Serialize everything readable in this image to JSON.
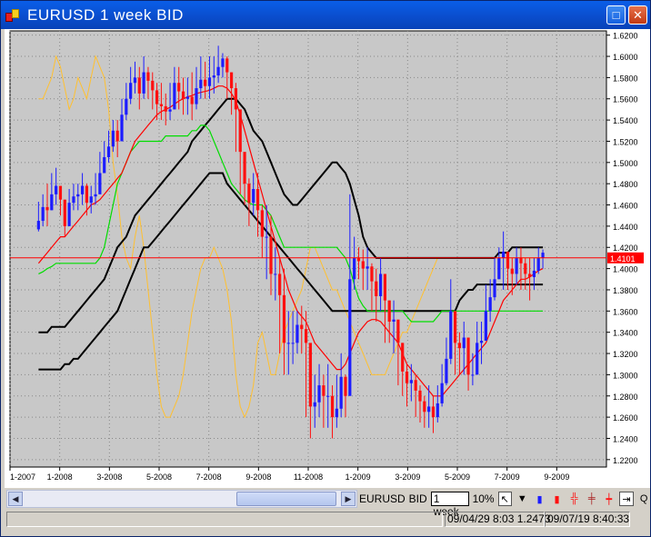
{
  "window": {
    "title": "EURUSD 1  week BID",
    "max_symbol": "□",
    "close_symbol": "✕"
  },
  "colors": {
    "title_bar": "#0a52d8",
    "chart_bg": "#c8c8c8",
    "bull_candle": "#1c1cff",
    "bear_candle": "#ff1010",
    "price_line": "#ff0000",
    "red_ma": "#ff0000",
    "green_ma": "#00dd00",
    "envelope": "#000000",
    "oscillator": "#ffc030"
  },
  "chart_data": {
    "type": "candlestick",
    "symbol": "EURUSD",
    "timeframe": "1 week",
    "price_axis": [
      "1.6200",
      "1.6000",
      "1.5800",
      "1.5600",
      "1.5400",
      "1.5200",
      "1.5000",
      "1.4800",
      "1.4600",
      "1.4400",
      "1.4200",
      "1.4000",
      "1.3800",
      "1.3600",
      "1.3400",
      "1.3200",
      "1.3000",
      "1.2800",
      "1.2600",
      "1.2400",
      "1.2200"
    ],
    "ylim": [
      1.213,
      1.624
    ],
    "time_axis": [
      "1-2007",
      "1-2008",
      "3-2008",
      "5-2008",
      "7-2008",
      "9-2008",
      "11-2008",
      "1-2009",
      "3-2009",
      "5-2009",
      "7-2009",
      "9-2009"
    ],
    "current_price": "1.4101",
    "current_price_value": 1.4101,
    "weeks": 136,
    "close": [
      1.445,
      1.458,
      1.455,
      1.47,
      1.478,
      1.465,
      1.44,
      1.462,
      1.468,
      1.47,
      1.478,
      1.462,
      1.468,
      1.47,
      1.49,
      1.505,
      1.515,
      1.53,
      1.52,
      1.545,
      1.56,
      1.575,
      1.58,
      1.565,
      1.585,
      1.577,
      1.568,
      1.555,
      1.553,
      1.548,
      1.55,
      1.575,
      1.567,
      1.56,
      1.562,
      1.555,
      1.57,
      1.578,
      1.572,
      1.58,
      1.582,
      1.59,
      1.598,
      1.585,
      1.57,
      1.55,
      1.51,
      1.48,
      1.462,
      1.475,
      1.455,
      1.43,
      1.43,
      1.395,
      1.395,
      1.375,
      1.33,
      1.33,
      1.33,
      1.347,
      1.343,
      1.33,
      1.27,
      1.274,
      1.29,
      1.28,
      1.28,
      1.26,
      1.268,
      1.298,
      1.28,
      1.39,
      1.41,
      1.407,
      1.4,
      1.402,
      1.388,
      1.374,
      1.395,
      1.37,
      1.35,
      1.352,
      1.33,
      1.303,
      1.292,
      1.295,
      1.285,
      1.275,
      1.265,
      1.27,
      1.26,
      1.273,
      1.292,
      1.315,
      1.36,
      1.33,
      1.325,
      1.335,
      1.3,
      1.3,
      1.33,
      1.332,
      1.36,
      1.373,
      1.39,
      1.41,
      1.416,
      1.4,
      1.395,
      1.41,
      1.405,
      1.395,
      1.392,
      1.398,
      1.41,
      1.415
    ],
    "high": [
      1.463,
      1.47,
      1.48,
      1.49,
      1.495,
      1.475,
      1.465,
      1.475,
      1.48,
      1.48,
      1.49,
      1.48,
      1.478,
      1.49,
      1.51,
      1.52,
      1.53,
      1.54,
      1.54,
      1.56,
      1.575,
      1.59,
      1.595,
      1.59,
      1.6,
      1.59,
      1.585,
      1.575,
      1.575,
      1.565,
      1.575,
      1.59,
      1.59,
      1.58,
      1.58,
      1.585,
      1.59,
      1.6,
      1.595,
      1.6,
      1.6,
      1.61,
      1.603,
      1.6,
      1.585,
      1.575,
      1.55,
      1.495,
      1.485,
      1.49,
      1.49,
      1.46,
      1.46,
      1.45,
      1.42,
      1.41,
      1.4,
      1.36,
      1.36,
      1.36,
      1.365,
      1.36,
      1.32,
      1.3,
      1.31,
      1.3,
      1.31,
      1.29,
      1.3,
      1.32,
      1.3,
      1.47,
      1.43,
      1.42,
      1.418,
      1.42,
      1.405,
      1.4,
      1.41,
      1.39,
      1.37,
      1.37,
      1.35,
      1.33,
      1.31,
      1.31,
      1.3,
      1.29,
      1.28,
      1.29,
      1.28,
      1.29,
      1.31,
      1.335,
      1.39,
      1.36,
      1.34,
      1.35,
      1.32,
      1.32,
      1.35,
      1.35,
      1.385,
      1.39,
      1.41,
      1.42,
      1.435,
      1.415,
      1.41,
      1.42,
      1.42,
      1.41,
      1.41,
      1.41,
      1.42,
      1.418
    ],
    "low": [
      1.435,
      1.44,
      1.44,
      1.455,
      1.46,
      1.45,
      1.43,
      1.44,
      1.455,
      1.455,
      1.46,
      1.45,
      1.452,
      1.46,
      1.48,
      1.49,
      1.5,
      1.51,
      1.505,
      1.52,
      1.54,
      1.555,
      1.565,
      1.55,
      1.56,
      1.56,
      1.55,
      1.54,
      1.54,
      1.535,
      1.54,
      1.55,
      1.55,
      1.545,
      1.545,
      1.54,
      1.55,
      1.56,
      1.56,
      1.56,
      1.565,
      1.575,
      1.58,
      1.56,
      1.545,
      1.51,
      1.47,
      1.46,
      1.44,
      1.45,
      1.43,
      1.41,
      1.39,
      1.375,
      1.37,
      1.32,
      1.3,
      1.3,
      1.31,
      1.32,
      1.32,
      1.26,
      1.24,
      1.25,
      1.26,
      1.25,
      1.25,
      1.24,
      1.25,
      1.26,
      1.26,
      1.38,
      1.38,
      1.39,
      1.38,
      1.38,
      1.36,
      1.35,
      1.36,
      1.33,
      1.33,
      1.32,
      1.29,
      1.28,
      1.27,
      1.275,
      1.26,
      1.255,
      1.25,
      1.25,
      1.245,
      1.255,
      1.27,
      1.29,
      1.31,
      1.3,
      1.3,
      1.3,
      1.285,
      1.29,
      1.31,
      1.31,
      1.35,
      1.35,
      1.37,
      1.39,
      1.38,
      1.38,
      1.375,
      1.385,
      1.38,
      1.38,
      1.37,
      1.38,
      1.395,
      1.4
    ],
    "red_ma": [
      1.405,
      1.41,
      1.415,
      1.42,
      1.425,
      1.43,
      1.43,
      1.435,
      1.44,
      1.445,
      1.45,
      1.455,
      1.46,
      1.462,
      1.465,
      1.47,
      1.475,
      1.48,
      1.485,
      1.49,
      1.5,
      1.51,
      1.52,
      1.525,
      1.53,
      1.535,
      1.54,
      1.545,
      1.548,
      1.55,
      1.552,
      1.555,
      1.558,
      1.56,
      1.562,
      1.563,
      1.565,
      1.566,
      1.567,
      1.568,
      1.57,
      1.572,
      1.572,
      1.57,
      1.565,
      1.558,
      1.545,
      1.53,
      1.515,
      1.5,
      1.485,
      1.47,
      1.455,
      1.44,
      1.425,
      1.41,
      1.395,
      1.38,
      1.37,
      1.36,
      1.355,
      1.35,
      1.34,
      1.33,
      1.325,
      1.32,
      1.315,
      1.31,
      1.305,
      1.305,
      1.31,
      1.32,
      1.33,
      1.34,
      1.345,
      1.35,
      1.352,
      1.352,
      1.35,
      1.345,
      1.34,
      1.335,
      1.33,
      1.32,
      1.31,
      1.305,
      1.3,
      1.295,
      1.29,
      1.285,
      1.28,
      1.28,
      1.28,
      1.285,
      1.29,
      1.295,
      1.3,
      1.305,
      1.31,
      1.315,
      1.32,
      1.325,
      1.33,
      1.34,
      1.35,
      1.36,
      1.37,
      1.375,
      1.38,
      1.385,
      1.39,
      1.39,
      1.392,
      1.395,
      1.398,
      1.4
    ],
    "green_ma": [
      1.395,
      1.397,
      1.4,
      1.402,
      1.405,
      1.405,
      1.405,
      1.405,
      1.405,
      1.405,
      1.405,
      1.405,
      1.405,
      1.405,
      1.41,
      1.42,
      1.44,
      1.46,
      1.48,
      1.49,
      1.5,
      1.51,
      1.515,
      1.52,
      1.52,
      1.52,
      1.52,
      1.52,
      1.52,
      1.525,
      1.525,
      1.525,
      1.525,
      1.525,
      1.525,
      1.53,
      1.53,
      1.535,
      1.535,
      1.53,
      1.52,
      1.51,
      1.5,
      1.49,
      1.48,
      1.475,
      1.47,
      1.465,
      1.462,
      1.46,
      1.46,
      1.46,
      1.455,
      1.45,
      1.44,
      1.43,
      1.42,
      1.42,
      1.42,
      1.42,
      1.42,
      1.42,
      1.42,
      1.42,
      1.42,
      1.42,
      1.42,
      1.42,
      1.42,
      1.415,
      1.41,
      1.4,
      1.385,
      1.372,
      1.365,
      1.36,
      1.36,
      1.36,
      1.36,
      1.36,
      1.36,
      1.36,
      1.36,
      1.36,
      1.355,
      1.35,
      1.35,
      1.35,
      1.35,
      1.35,
      1.35,
      1.355,
      1.36,
      1.36,
      1.36,
      1.36,
      1.36,
      1.36,
      1.36,
      1.36,
      1.36,
      1.36,
      1.36,
      1.36,
      1.36,
      1.36,
      1.36,
      1.36,
      1.36,
      1.36,
      1.36,
      1.36,
      1.36,
      1.36,
      1.36,
      1.36
    ],
    "env_upper": [
      1.34,
      1.34,
      1.34,
      1.345,
      1.345,
      1.345,
      1.345,
      1.35,
      1.355,
      1.36,
      1.365,
      1.37,
      1.375,
      1.38,
      1.385,
      1.39,
      1.4,
      1.41,
      1.42,
      1.425,
      1.43,
      1.44,
      1.45,
      1.455,
      1.46,
      1.465,
      1.47,
      1.475,
      1.48,
      1.485,
      1.49,
      1.495,
      1.5,
      1.505,
      1.51,
      1.52,
      1.525,
      1.53,
      1.535,
      1.54,
      1.545,
      1.55,
      1.555,
      1.56,
      1.56,
      1.56,
      1.555,
      1.55,
      1.54,
      1.53,
      1.525,
      1.52,
      1.51,
      1.5,
      1.49,
      1.48,
      1.47,
      1.465,
      1.46,
      1.46,
      1.465,
      1.47,
      1.475,
      1.48,
      1.485,
      1.49,
      1.495,
      1.5,
      1.5,
      1.495,
      1.49,
      1.48,
      1.465,
      1.45,
      1.43,
      1.42,
      1.415,
      1.41,
      1.41,
      1.41,
      1.41,
      1.41,
      1.41,
      1.41,
      1.41,
      1.41,
      1.41,
      1.41,
      1.41,
      1.41,
      1.41,
      1.41,
      1.41,
      1.41,
      1.41,
      1.41,
      1.41,
      1.41,
      1.41,
      1.41,
      1.41,
      1.41,
      1.41,
      1.41,
      1.41,
      1.415,
      1.415,
      1.415,
      1.42,
      1.42,
      1.42,
      1.42,
      1.42,
      1.42,
      1.42,
      1.42
    ],
    "env_lower": [
      1.305,
      1.305,
      1.305,
      1.305,
      1.305,
      1.305,
      1.31,
      1.31,
      1.315,
      1.315,
      1.32,
      1.325,
      1.33,
      1.335,
      1.34,
      1.345,
      1.35,
      1.355,
      1.36,
      1.37,
      1.38,
      1.39,
      1.4,
      1.41,
      1.42,
      1.42,
      1.425,
      1.43,
      1.435,
      1.44,
      1.445,
      1.45,
      1.455,
      1.46,
      1.465,
      1.47,
      1.475,
      1.48,
      1.485,
      1.49,
      1.49,
      1.49,
      1.49,
      1.48,
      1.475,
      1.47,
      1.465,
      1.46,
      1.455,
      1.45,
      1.445,
      1.44,
      1.435,
      1.43,
      1.425,
      1.42,
      1.415,
      1.41,
      1.405,
      1.4,
      1.395,
      1.39,
      1.385,
      1.38,
      1.375,
      1.37,
      1.365,
      1.36,
      1.36,
      1.36,
      1.36,
      1.36,
      1.36,
      1.36,
      1.36,
      1.36,
      1.36,
      1.36,
      1.36,
      1.36,
      1.36,
      1.36,
      1.36,
      1.36,
      1.36,
      1.36,
      1.36,
      1.36,
      1.36,
      1.36,
      1.36,
      1.36,
      1.36,
      1.36,
      1.36,
      1.36,
      1.37,
      1.375,
      1.38,
      1.38,
      1.385,
      1.385,
      1.385,
      1.385,
      1.385,
      1.385,
      1.385,
      1.385,
      1.385,
      1.385,
      1.385,
      1.385,
      1.385,
      1.385,
      1.385,
      1.385
    ],
    "oscillator": [
      1.56,
      1.56,
      1.57,
      1.58,
      1.6,
      1.59,
      1.57,
      1.55,
      1.56,
      1.58,
      1.57,
      1.56,
      1.58,
      1.6,
      1.59,
      1.58,
      1.55,
      1.5,
      1.47,
      1.43,
      1.41,
      1.4,
      1.43,
      1.45,
      1.42,
      1.38,
      1.34,
      1.3,
      1.27,
      1.26,
      1.26,
      1.27,
      1.28,
      1.3,
      1.33,
      1.36,
      1.38,
      1.4,
      1.41,
      1.41,
      1.42,
      1.41,
      1.4,
      1.38,
      1.35,
      1.3,
      1.27,
      1.26,
      1.27,
      1.29,
      1.33,
      1.34,
      1.32,
      1.3,
      1.3,
      1.32,
      1.34,
      1.35,
      1.36,
      1.37,
      1.38,
      1.4,
      1.42,
      1.42,
      1.41,
      1.4,
      1.39,
      1.38,
      1.38,
      1.37,
      1.36,
      1.35,
      1.34,
      1.33,
      1.32,
      1.31,
      1.3,
      1.3,
      1.3,
      1.3,
      1.31,
      1.32,
      1.33,
      1.34,
      1.34,
      1.35,
      1.36,
      1.37,
      1.38,
      1.39,
      1.4,
      1.41,
      1.41,
      1.41,
      1.41,
      1.41,
      1.41,
      1.41,
      1.41,
      1.41,
      1.41,
      1.41,
      1.41,
      1.41,
      1.41,
      1.41,
      1.41,
      1.41,
      1.41,
      1.41,
      1.41,
      1.41,
      1.41,
      1.41,
      1.41,
      1.41
    ]
  },
  "toolbar": {
    "symbol": "EURUSD",
    "side": "BID",
    "period": "1 week",
    "zoom": "10%"
  },
  "statusbar": {
    "range": "09/04/29 8:03  1.2473",
    "clock": "09/07/19 8:40:33"
  }
}
